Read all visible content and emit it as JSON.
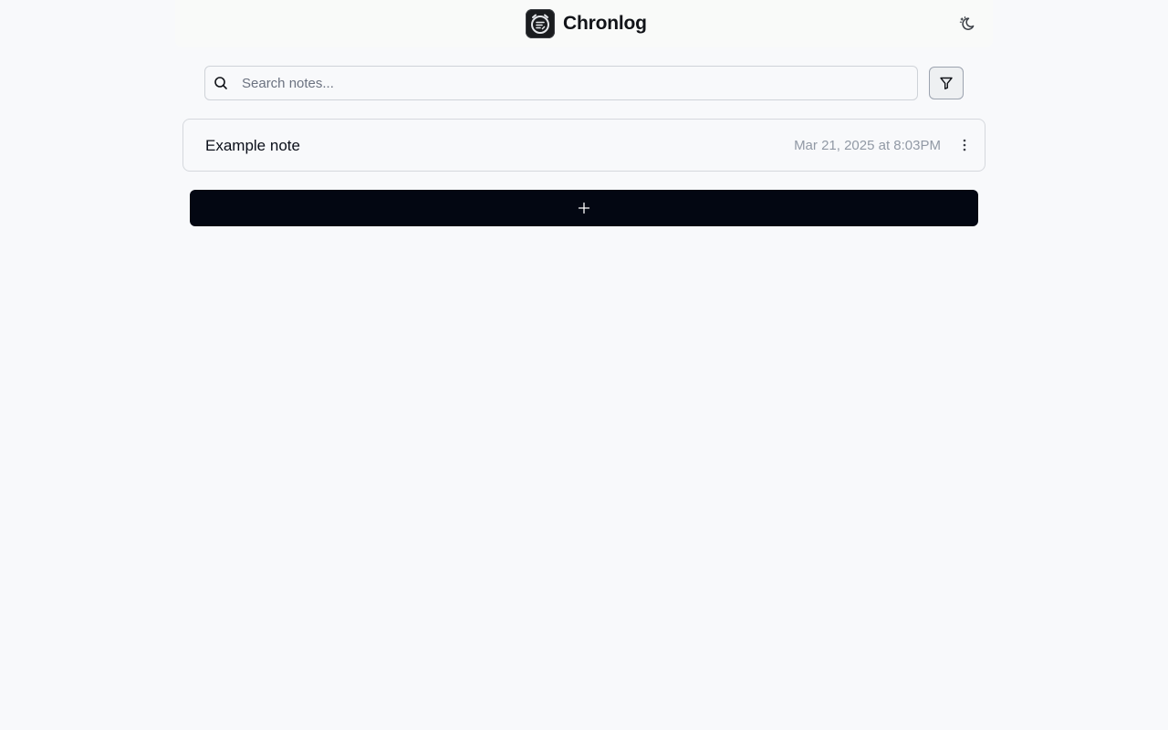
{
  "app": {
    "title": "Chronlog",
    "logo_icon": "alarm-clock-notes-icon",
    "theme_toggle_icon": "moon-sun-icon"
  },
  "search": {
    "placeholder": "Search notes...",
    "value": "",
    "icon": "search-icon"
  },
  "filter": {
    "icon": "filter-icon"
  },
  "notes": [
    {
      "title": "Example note",
      "date": "Mar 21, 2025 at 8:03PM",
      "menu_icon": "more-vertical-icon"
    }
  ],
  "add_button": {
    "icon": "plus-icon"
  },
  "colors": {
    "background": "#f8f9fb",
    "primary_button": "#030712",
    "muted_text": "#9199a5",
    "border": "#d5d8dd"
  }
}
